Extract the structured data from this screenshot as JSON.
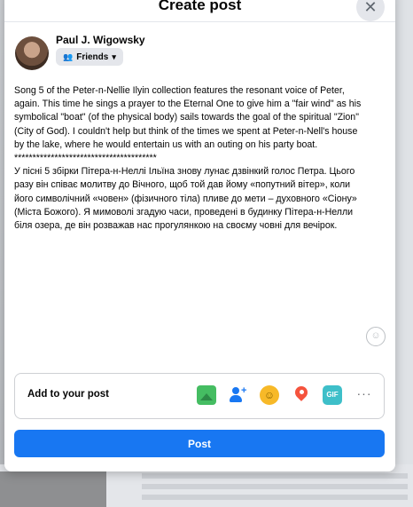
{
  "dialog": {
    "title": "Create post",
    "close_symbol": "✕"
  },
  "author": {
    "name": "Paul J. Wigowsky",
    "audience": "Friends",
    "audience_icon": "people-icon",
    "dropdown_icon": "caret-down-icon"
  },
  "post": {
    "text": "Song 5 of the Peter-n-Nellie Ilyin collection features the resonant voice of Peter, again. This time he sings a prayer to the Eternal One to give him a \"fair wind\" as his symbolical \"boat\" (of the physical body) sails towards the goal of the spiritual \"Zion\" (City of God). I couldn't help but think of the times we spent at Peter-n-Nell's house by the lake, where he would entertain us with an outing on his party boat.\n***************************************\nУ пісні 5 збірки Пітера-н-Неллі Ільїна знову лунає дзвінкий голос Петра. Цього разу він співає молитву до Вічного, щоб той дав йому «попутний вітер», коли його символічний «човен» (фізичного тіла) пливе до мети – духовного «Сіону» (Міста Божого). Я мимоволі згадую часи, проведені в будинку Пітера-н-Нелли біля озера, де він розважав нас прогулянкою на своєму човні для вечірок."
  },
  "add_to_post": {
    "label": "Add to your post",
    "tools": [
      "photo-video-icon",
      "tag-people-icon",
      "feeling-icon",
      "check-in-icon",
      "gif-icon",
      "more-icon"
    ],
    "gif_label": "GIF",
    "more_label": "···"
  },
  "actions": {
    "post_label": "Post"
  },
  "colors": {
    "primary": "#1877f2",
    "photo": "#45bd62",
    "feeling": "#f7b928",
    "location": "#f5533d",
    "gif": "#3ebfc9"
  }
}
